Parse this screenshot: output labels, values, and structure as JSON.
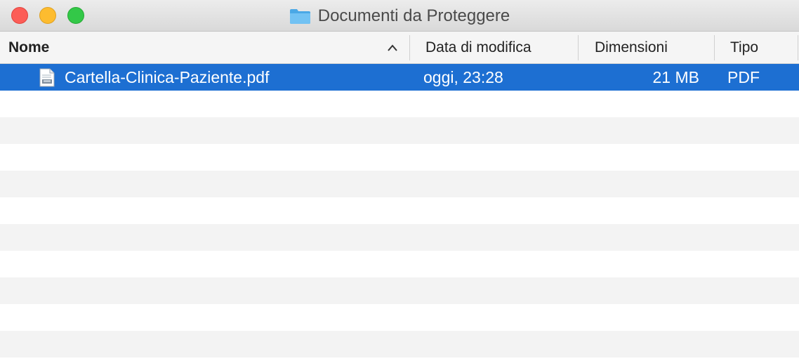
{
  "window": {
    "title": "Documenti da Proteggere",
    "title_icon": "folder-icon",
    "controls": [
      "close",
      "minimize",
      "zoom"
    ]
  },
  "columns": {
    "name": "Nome",
    "date": "Data di modifica",
    "size": "Dimensioni",
    "kind": "Tipo",
    "sort_column": "Nome",
    "sort_direction": "ascending"
  },
  "files": [
    {
      "name": "Cartella-Clinica-Paziente.pdf",
      "icon": "pdf-file-icon",
      "modified": "oggi, 23:28",
      "size": "21 MB",
      "kind": "PDF",
      "selected": true
    }
  ],
  "colors": {
    "selection": "#1d6fd2",
    "close": "#fc5d57",
    "minimize": "#fdbc2f",
    "zoom": "#33c848",
    "folder": "#5fb8ef"
  }
}
